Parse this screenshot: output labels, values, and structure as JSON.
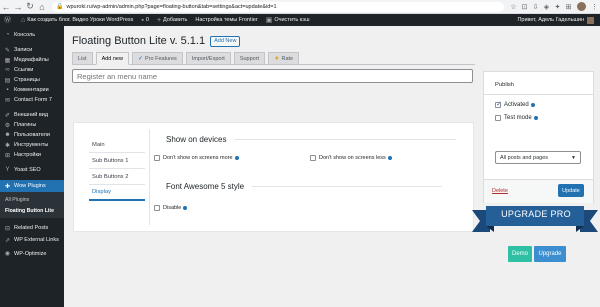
{
  "browser": {
    "url": "wpuroki.ru/wp-admin/admin.php?page=floating-button&tab=settings&act=update&id=1"
  },
  "adminbar": {
    "site_name": "Как создать блог. Видео Уроки WordPress",
    "comments_count": "0",
    "add_label": "Добавить",
    "theme_settings": "Настройка темы Frontier",
    "clear_cache": "Очистить кэш",
    "greeting": "Привет, Адель Гадельшин"
  },
  "sidebar": {
    "items": [
      {
        "label": "Консоль",
        "icon": "dashboard-icon"
      },
      {
        "label": "Записи",
        "icon": "pin-icon"
      },
      {
        "label": "Медиафайлы",
        "icon": "media-icon"
      },
      {
        "label": "Ссылки",
        "icon": "link-icon"
      },
      {
        "label": "Страницы",
        "icon": "page-icon"
      },
      {
        "label": "Комментарии",
        "icon": "comment-icon"
      },
      {
        "label": "Contact Form 7",
        "icon": "mail-icon"
      },
      {
        "label": "Внешний вид",
        "icon": "brush-icon"
      },
      {
        "label": "Плагины",
        "icon": "plugin-icon"
      },
      {
        "label": "Пользователи",
        "icon": "user-icon"
      },
      {
        "label": "Инструменты",
        "icon": "wrench-icon"
      },
      {
        "label": "Настройки",
        "icon": "settings-icon"
      },
      {
        "label": "Yoast SEO",
        "icon": "yoast-icon"
      },
      {
        "label": "Wow Plugins",
        "icon": "wow-icon"
      }
    ],
    "submenu": [
      "All Plugins",
      "Floating Button Lite"
    ],
    "after": [
      {
        "label": "Related Posts",
        "icon": "related-icon"
      },
      {
        "label": "WP External Links",
        "icon": "external-link-icon"
      },
      {
        "label": "WP-Optimize",
        "icon": "optimize-icon"
      }
    ]
  },
  "page": {
    "title": "Floating Button Lite v. 5.1.1",
    "add_new": "Add New"
  },
  "tabs": [
    {
      "label": "List"
    },
    {
      "label": "Add new"
    },
    {
      "label": "Pro Features"
    },
    {
      "label": "Import/Export"
    },
    {
      "label": "Support"
    },
    {
      "label": "Rate"
    }
  ],
  "name_input": {
    "placeholder": "Register an menu name",
    "value": ""
  },
  "settings": {
    "nav": [
      "Main",
      "Sub Buttons 1",
      "Sub Buttons 2",
      "Display"
    ],
    "show_on_devices": "Show on devices",
    "dont_show_more": "Don't show on screens more",
    "dont_show_less": "Don't show on screens less",
    "font_awesome": "Font Awesome 5 style",
    "disable": "Disable"
  },
  "publish": {
    "title": "Publish",
    "activated": "Activated",
    "test_mode": "Test mode",
    "select_value": "All posts and pages",
    "delete": "Delete",
    "update": "Update"
  },
  "upgrade": {
    "banner": "UPGRADE PRO",
    "demo": "Demo",
    "upgrade": "Upgrade"
  }
}
